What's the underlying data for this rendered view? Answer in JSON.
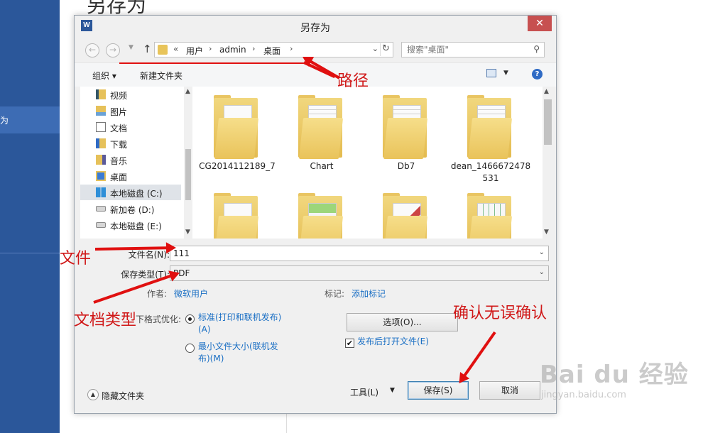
{
  "background": {
    "heading": "另存为",
    "sidebar_selected": "为"
  },
  "dialog": {
    "title": "另存为",
    "app_icon": "W",
    "close_icon": "✕"
  },
  "address": {
    "prefix": "«",
    "crumbs": [
      "用户",
      "admin",
      "桌面"
    ],
    "search_placeholder": "搜索\"桌面\""
  },
  "toolbar": {
    "organize": "组织 ▾",
    "new_folder": "新建文件夹"
  },
  "nav_items": [
    {
      "label": "视频",
      "icon": "video-folder-icon"
    },
    {
      "label": "图片",
      "icon": "pictures-folder-icon"
    },
    {
      "label": "文档",
      "icon": "documents-folder-icon"
    },
    {
      "label": "下载",
      "icon": "downloads-folder-icon"
    },
    {
      "label": "音乐",
      "icon": "music-folder-icon"
    },
    {
      "label": "桌面",
      "icon": "desktop-folder-icon"
    },
    {
      "label": "本地磁盘 (C:)",
      "icon": "windows-drive-icon",
      "selected": true
    },
    {
      "label": "新加卷 (D:)",
      "icon": "drive-icon"
    },
    {
      "label": "本地磁盘 (E:)",
      "icon": "drive-icon"
    }
  ],
  "files": [
    {
      "label": "CG2014112189_7",
      "kind": "plain"
    },
    {
      "label": "Chart",
      "kind": "lines"
    },
    {
      "label": "Db7",
      "kind": "lines"
    },
    {
      "label": "dean_1466672478531",
      "kind": "lines"
    },
    {
      "label": "",
      "kind": "plain"
    },
    {
      "label": "",
      "kind": "green"
    },
    {
      "label": "",
      "kind": "red"
    },
    {
      "label": "",
      "kind": "table"
    }
  ],
  "form": {
    "filename_label": "文件名(N):",
    "filename_value": "111",
    "filetype_label": "保存类型(T):",
    "filetype_value": "PDF",
    "author_label": "作者:",
    "author_value": "微软用户",
    "tags_label": "标记:",
    "tags_value": "添加标记",
    "optimize_label": "下格式优化:",
    "radio_standard": "标准(打印和联机发布)(A)",
    "radio_minimum": "最小文件大小(联机发布)(M)",
    "options_button": "选项(O)...",
    "open_after_label": "发布后打开文件(E)",
    "open_after_checked": true
  },
  "footer": {
    "hide_folders": "隐藏文件夹",
    "tools": "工具(L)",
    "save": "保存(S)",
    "cancel": "取消"
  },
  "annotations": {
    "path": "路径",
    "file": "文件",
    "doctype": "文档类型",
    "confirm": "确认无误确认"
  },
  "watermark": {
    "logo": "Bai du 经验",
    "sub": "jingyan.baidu.com"
  }
}
